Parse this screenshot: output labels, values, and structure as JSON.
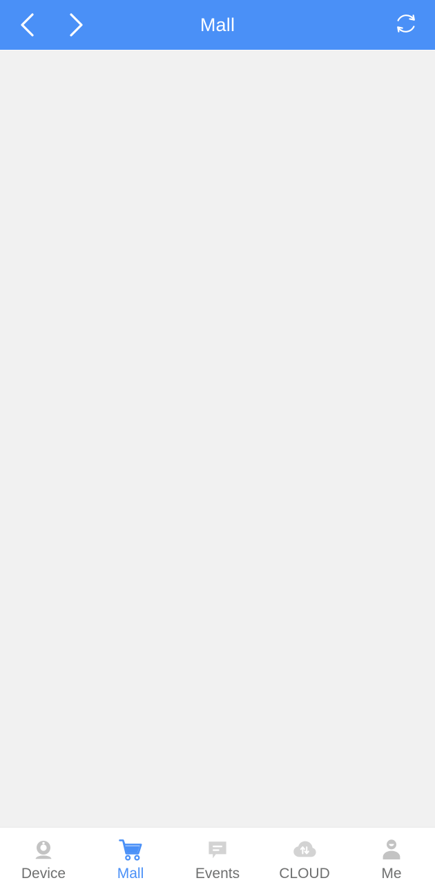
{
  "header": {
    "title": "Mall",
    "background_color": "#4a90f7",
    "text_color": "#ffffff",
    "back_label": "Back",
    "forward_label": "Forward",
    "refresh_label": "Refresh",
    "back_icon": "chevron-left-icon",
    "forward_icon": "chevron-right-icon",
    "refresh_icon": "refresh-icon"
  },
  "content": {
    "background_color": "#f1f1f1",
    "body_text": ""
  },
  "tabbar": {
    "active_color": "#4a90f7",
    "inactive_color": "#6f7070",
    "inactive_icon_color": "#c3c3c3",
    "background_color": "#ffffff",
    "items": [
      {
        "label": "Device",
        "icon": "webcam-icon",
        "active": false
      },
      {
        "label": "Mall",
        "icon": "shopping-cart-icon",
        "active": true
      },
      {
        "label": "Events",
        "icon": "chat-bubble-icon",
        "active": false
      },
      {
        "label": "CLOUD",
        "icon": "cloud-sync-icon",
        "active": false
      },
      {
        "label": "Me",
        "icon": "person-icon",
        "active": false
      }
    ]
  }
}
